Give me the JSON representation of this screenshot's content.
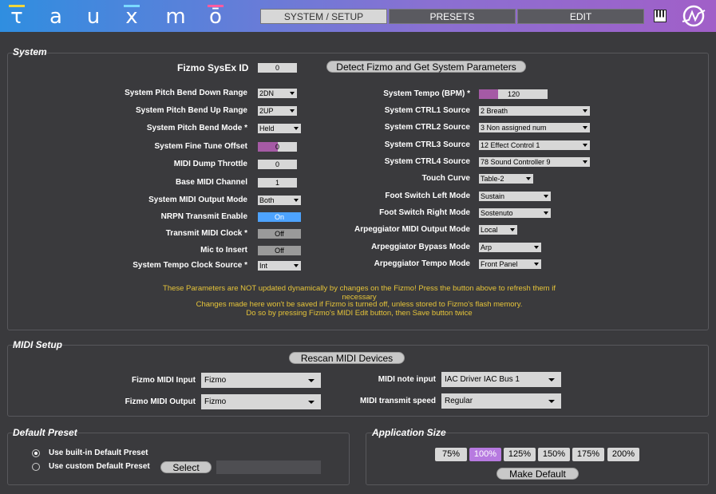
{
  "header": {
    "logo_letters": [
      "τ",
      "a",
      "u",
      "x",
      "m",
      "ō"
    ],
    "logo_colors": [
      "#f2d63a",
      "#7ad9ff",
      "#ff5aa0",
      "#ffffff"
    ],
    "tabs": [
      {
        "label": "SYSTEM / SETUP",
        "active": true
      },
      {
        "label": "PRESETS",
        "active": false
      },
      {
        "label": "EDIT",
        "active": false
      }
    ],
    "piano_icon": "piano-keyboard-icon",
    "synth_icon": "waveform-circle-icon"
  },
  "system": {
    "title": "System",
    "sysex_label": "Fizmo SysEx ID",
    "sysex_value": "0",
    "detect_button": "Detect Fizmo and Get System Parameters",
    "left": [
      {
        "label": "System Pitch Bend Down Range",
        "type": "drop",
        "value": "2DN"
      },
      {
        "label": "System Pitch Bend Up Range",
        "type": "drop",
        "value": "2UP"
      },
      {
        "label": "System Pitch Bend Mode *",
        "type": "drop",
        "value": "Held"
      },
      {
        "label": "System Fine Tune Offset",
        "type": "slider",
        "value": "0",
        "fill": 0.5
      },
      {
        "label": "MIDI Dump Throttle",
        "type": "num",
        "value": "0"
      },
      {
        "label": "Base MIDI Channel",
        "type": "num",
        "value": "1"
      },
      {
        "label": "System MIDI Output Mode",
        "type": "drop",
        "value": "Both"
      },
      {
        "label": "NRPN Transmit Enable",
        "type": "toggle",
        "value": "On"
      },
      {
        "label": "Transmit MIDI Clock *",
        "type": "toggle",
        "value": "Off"
      },
      {
        "label": "Mic to Insert",
        "type": "toggle",
        "value": "Off"
      },
      {
        "label": "System Tempo Clock Source *",
        "type": "drop",
        "value": "Int"
      }
    ],
    "right": [
      {
        "label": "System Tempo (BPM) *",
        "type": "tempo",
        "value": "120",
        "fill": 0.28
      },
      {
        "label": "System CTRL1 Source",
        "type": "drop",
        "value": "2 Breath"
      },
      {
        "label": "System CTRL2 Source",
        "type": "drop",
        "value": "3 Non assigned num"
      },
      {
        "label": "System CTRL3 Source",
        "type": "drop",
        "value": "12 Effect Control 1"
      },
      {
        "label": "System CTRL4 Source",
        "type": "drop",
        "value": "78 Sound Controller 9"
      },
      {
        "label": "Touch Curve",
        "type": "drop",
        "value": "Table-2"
      },
      {
        "label": "Foot Switch Left Mode",
        "type": "drop",
        "value": "Sustain"
      },
      {
        "label": "Foot Switch Right Mode",
        "type": "drop",
        "value": "Sostenuto"
      },
      {
        "label": "Arpeggiator MIDI Output Mode",
        "type": "drop",
        "value": "Local"
      },
      {
        "label": "Arpeggiator Bypass Mode",
        "type": "drop",
        "value": "Arp"
      },
      {
        "label": "Arpeggiator Tempo Mode",
        "type": "drop",
        "value": "Front Panel"
      }
    ],
    "warning_lines": [
      "These Parameters are NOT updated dynamically by changes on the Fizmo!  Press the button above to refresh them if",
      "necessary",
      "Changes made here won't be saved if Fizmo is turned off, unless stored to Fizmo's flash memory.",
      "Do so by pressing Fizmo's MIDI Edit button, then Save button twice"
    ]
  },
  "midi": {
    "title": "MIDI Setup",
    "rescan_button": "Rescan MIDI Devices",
    "input_label": "Fizmo MIDI Input",
    "input_value": "Fizmo",
    "output_label": "Fizmo MIDI Output",
    "output_value": "Fizmo",
    "note_input_label": "MIDI note input",
    "note_input_value": "IAC Driver IAC Bus 1",
    "speed_label": "MIDI transmit speed",
    "speed_value": "Regular"
  },
  "preset": {
    "title": "Default Preset",
    "builtin_label": "Use built-in Default Preset",
    "custom_label": "Use custom Default Preset",
    "select_button": "Select",
    "path_value": "",
    "selected": "builtin"
  },
  "appsize": {
    "title": "Application Size",
    "sizes": [
      "75%",
      "100%",
      "125%",
      "150%",
      "175%",
      "200%"
    ],
    "active": "100%",
    "make_default": "Make Default",
    "accent": "#b77ae0"
  },
  "colors": {
    "slider_fill": "#a55aa5",
    "toggle_on": "#4da3ff",
    "warning": "#e6c439"
  }
}
